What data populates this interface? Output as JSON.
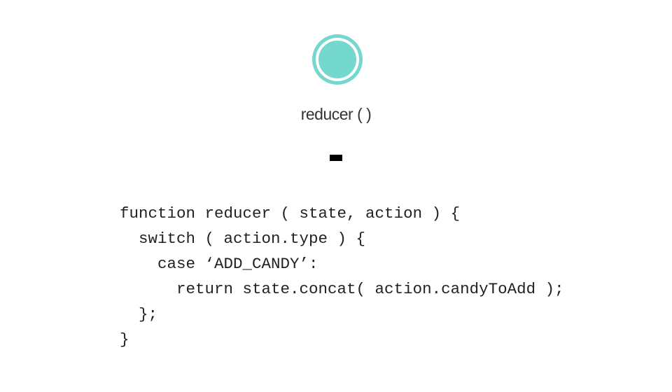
{
  "slide": {
    "title": "reducer ( )",
    "accent_color": "#75d8cf",
    "logo_icon": "ring-circle-icon",
    "cursor_icon": "text-cursor-block"
  },
  "code": {
    "lines": [
      "function reducer ( state, action ) {",
      "  switch ( action.type ) {",
      "    case ‘ADD_CANDY’:",
      "      return state.concat( action.candyToAdd );",
      "  };",
      "}"
    ]
  }
}
